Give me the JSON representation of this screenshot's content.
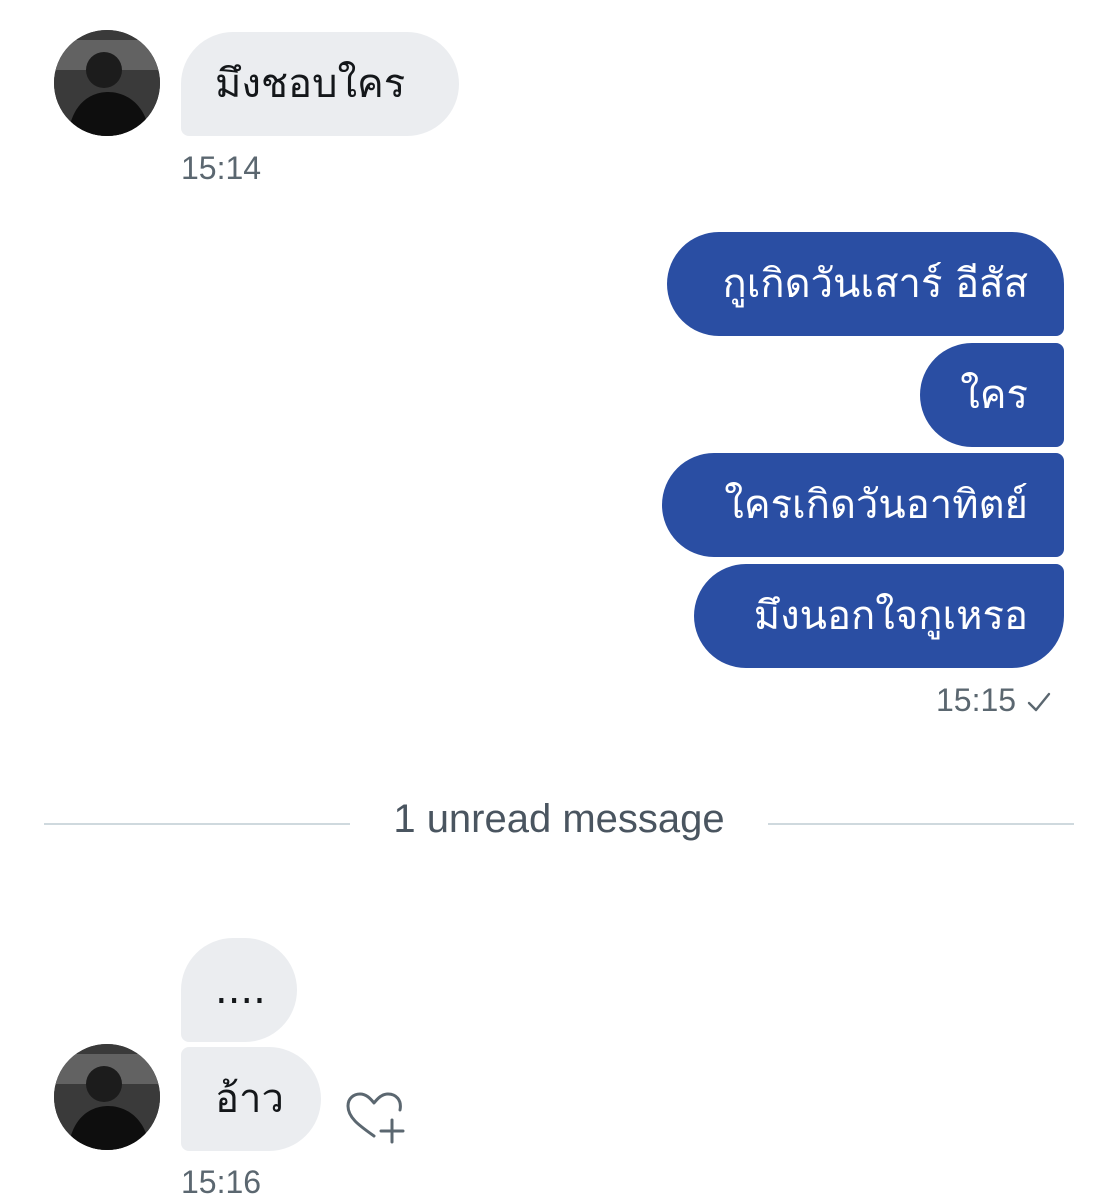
{
  "messages": {
    "first_incoming": {
      "text": "มึงชอบใคร",
      "time": "15:14"
    },
    "outgoing": [
      {
        "text": "กูเกิดวันเสาร์ อีสัส"
      },
      {
        "text": "ใคร"
      },
      {
        "text": "ใครเกิดวันอาทิตย์"
      },
      {
        "text": "มึงนอกใจกูเหรอ"
      }
    ],
    "outgoing_time": "15:15",
    "outgoing_status_icon": "checkmark-icon",
    "divider": "1 unread message",
    "last_incoming": [
      {
        "text": "...."
      },
      {
        "text": "อ้าว"
      }
    ],
    "last_incoming_time": "15:16",
    "reaction_icon": "heart-plus-icon"
  },
  "colors": {
    "outgoing_bubble": "#2a4ea3",
    "incoming_bubble": "#ebedf0",
    "timestamp": "#5b6770",
    "divider_line": "#cfd9de"
  }
}
